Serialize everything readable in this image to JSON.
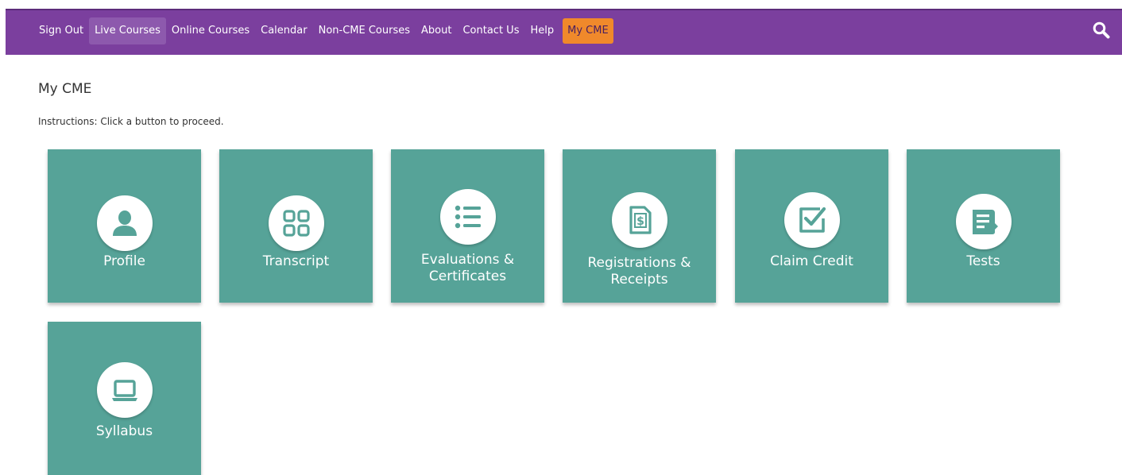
{
  "nav": {
    "items": [
      {
        "label": "Sign Out"
      },
      {
        "label": "Live Courses"
      },
      {
        "label": "Online Courses"
      },
      {
        "label": "Calendar"
      },
      {
        "label": "Non-CME Courses"
      },
      {
        "label": "About"
      },
      {
        "label": "Contact Us"
      },
      {
        "label": "Help"
      },
      {
        "label": "My CME"
      }
    ],
    "hover_item": "Live Courses",
    "active_item": "My CME",
    "search_icon": "search-icon"
  },
  "page": {
    "title": "My CME",
    "instructions": "Instructions: Click a button to proceed."
  },
  "tiles": [
    {
      "label_line1": "Profile",
      "label_line2": "",
      "icon": "user-icon"
    },
    {
      "label_line1": "Transcript",
      "label_line2": "",
      "icon": "grid-icon"
    },
    {
      "label_line1": "Evaluations &",
      "label_line2": "Certificates",
      "icon": "list-icon"
    },
    {
      "label_line1": "Registrations &",
      "label_line2": "Receipts",
      "icon": "receipt-dollar-icon"
    },
    {
      "label_line1": "Claim Credit",
      "label_line2": "",
      "icon": "checkbox-icon"
    },
    {
      "label_line1": "Tests",
      "label_line2": "",
      "icon": "test-document-icon"
    },
    {
      "label_line1": "Syllabus",
      "label_line2": "",
      "icon": "laptop-icon"
    }
  ],
  "colors": {
    "nav_bg": "#7b3f9e",
    "active_bg": "#f0892b",
    "tile_bg": "#56a398",
    "icon_color": "#56a398"
  }
}
